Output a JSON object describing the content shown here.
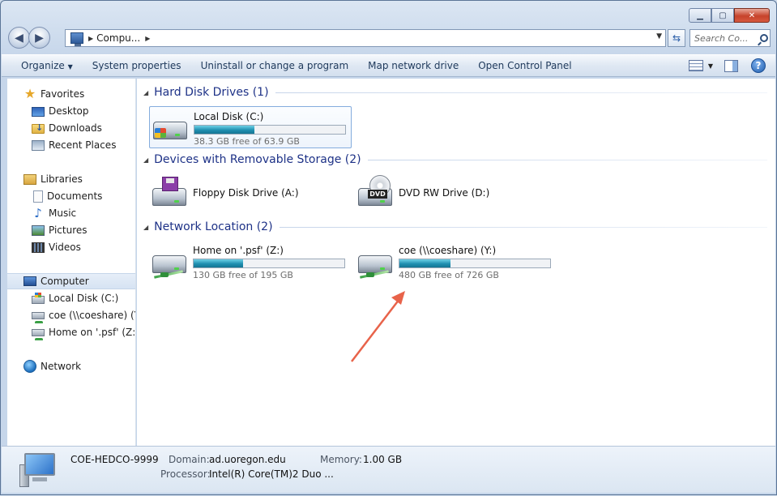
{
  "address": {
    "breadcrumb": "Compu..."
  },
  "search": {
    "placeholder": "Search Co..."
  },
  "toolbar": {
    "organize": "Organize",
    "system_properties": "System properties",
    "uninstall": "Uninstall or change a program",
    "map_drive": "Map network drive",
    "control_panel": "Open Control Panel"
  },
  "nav": {
    "favorites": "Favorites",
    "desktop": "Desktop",
    "downloads": "Downloads",
    "recent": "Recent Places",
    "libraries": "Libraries",
    "documents": "Documents",
    "music": "Music",
    "pictures": "Pictures",
    "videos": "Videos",
    "computer": "Computer",
    "local_disk": "Local Disk (C:)",
    "coe": "coe (\\\\coeshare) (Y:)",
    "home": "Home on '.psf' (Z:)",
    "network": "Network"
  },
  "groups": {
    "hdd": "Hard Disk Drives (1)",
    "removable": "Devices with Removable Storage (2)",
    "network": "Network Location (2)"
  },
  "drives": {
    "c": {
      "name": "Local Disk (C:)",
      "free": "38.3 GB free of 63.9 GB",
      "used_fraction": 0.4
    },
    "a": {
      "name": "Floppy Disk Drive (A:)"
    },
    "d": {
      "name": "DVD RW Drive (D:)"
    },
    "z": {
      "name": "Home on '.psf' (Z:)",
      "free": "130 GB free of 195 GB",
      "used_fraction": 0.33
    },
    "y": {
      "name": "coe (\\\\coeshare) (Y:)",
      "free": "480 GB free of 726 GB",
      "used_fraction": 0.34
    }
  },
  "details": {
    "computer_name": "COE-HEDCO-9999",
    "domain_label": "Domain:",
    "domain_value": "ad.uoregon.edu",
    "memory_label": "Memory:",
    "memory_value": "1.00 GB",
    "processor_label": "Processor:",
    "processor_value": "Intel(R) Core(TM)2 Duo ..."
  },
  "colors": {
    "annotation_arrow": "#e8634a",
    "group_title": "#1e3287",
    "bar_fill": "#1f8fb0"
  }
}
